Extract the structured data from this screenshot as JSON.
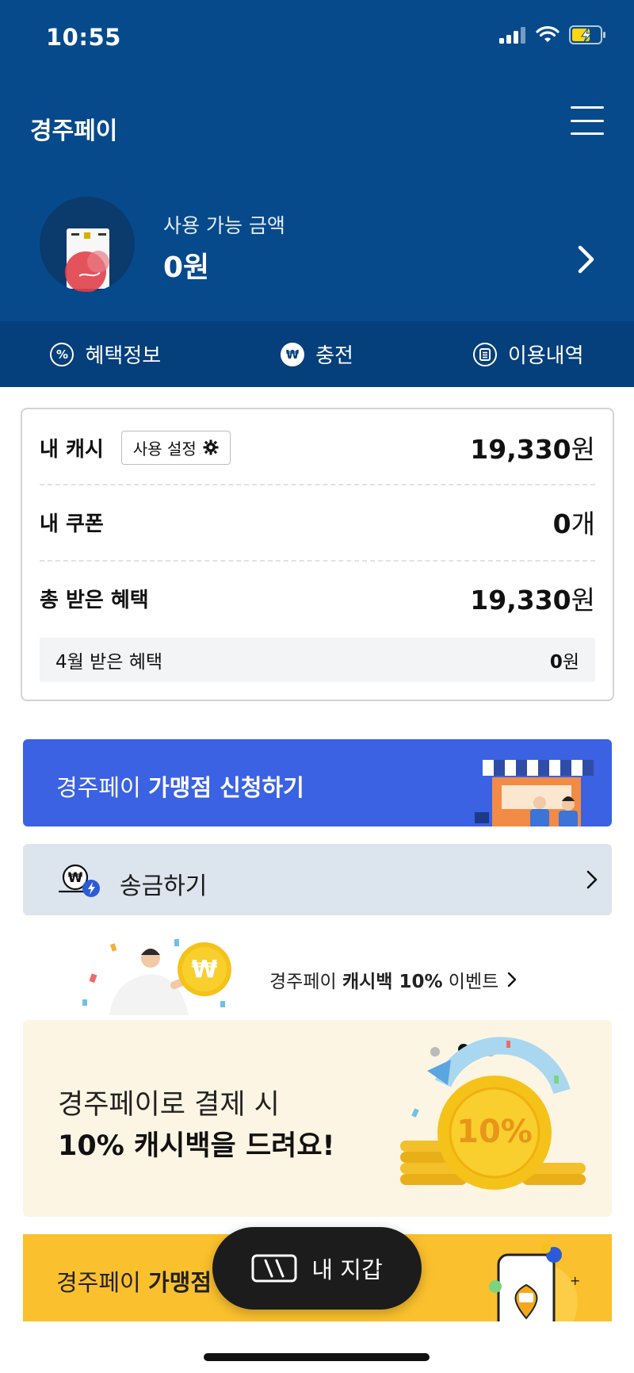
{
  "status_bar": {
    "time": "10:55"
  },
  "header": {
    "app_title": "경주페이",
    "balance_label": "사용 가능 금액",
    "balance_amount": "0원"
  },
  "nav": [
    {
      "label": "혜택정보",
      "icon": "percent-icon"
    },
    {
      "label": "충전",
      "icon": "won-icon"
    },
    {
      "label": "이용내역",
      "icon": "receipt-icon"
    }
  ],
  "summary": {
    "cash_label": "내 캐시",
    "setting_button": "사용 설정",
    "cash_value": "19,330",
    "cash_unit": "원",
    "coupon_label": "내 쿠폰",
    "coupon_value": "0",
    "coupon_unit": "개",
    "benefit_label": "총 받은 혜택",
    "benefit_value": "19,330",
    "benefit_unit": "원",
    "monthly_label": "4월 받은 혜택",
    "monthly_value": "0",
    "monthly_unit": "원"
  },
  "merchant_banner": {
    "prefix": "경주페이 ",
    "bold": "가맹점 신청하기"
  },
  "remit": {
    "label": "송금하기"
  },
  "event": {
    "prefix": "경주페이 ",
    "bold": "캐시백 10%",
    "suffix": " 이벤트"
  },
  "cashback": {
    "line1": "경주페이로 결제 시",
    "line2": "10% 캐시백을 드려요!",
    "badge": "10%"
  },
  "yellow_banner": {
    "prefix": "경주페이 ",
    "bold": "가맹점"
  },
  "wallet_button": {
    "label": "내 지갑"
  },
  "colors": {
    "header_bg": "#064a8c",
    "nav_bg": "#053f7c",
    "merchant_bg": "#3b62e3",
    "remit_bg": "#dce4ee",
    "cashback_bg": "#fdf5e3",
    "yellow_bg": "#fbc02d"
  }
}
